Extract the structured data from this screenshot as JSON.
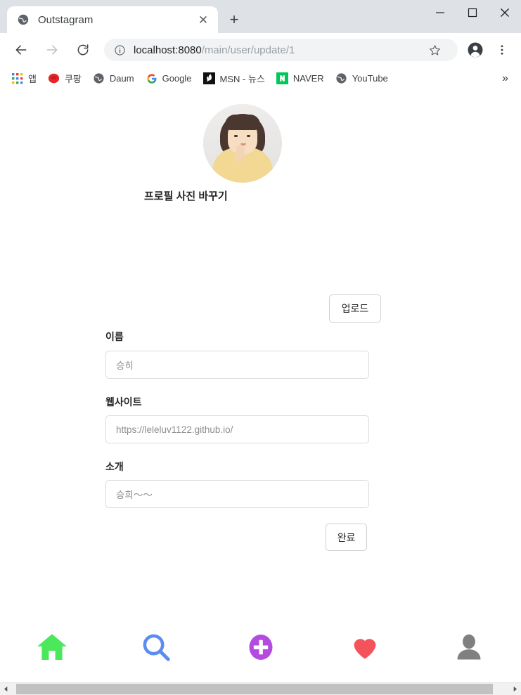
{
  "window": {
    "controls": [
      {
        "name": "minimize",
        "glyph": "—"
      },
      {
        "name": "maximize",
        "glyph": "☐"
      },
      {
        "name": "close",
        "glyph": "✕"
      }
    ]
  },
  "tabs": [
    {
      "title": "Outstagram",
      "favicon": "globe-icon",
      "close_glyph": "✕"
    }
  ],
  "newtab_glyph": "+",
  "toolbar": {
    "back_label": "←",
    "forward_label": "→",
    "reload_label": "↻",
    "url_host": "localhost:8080",
    "url_path": "/main/user/update/1",
    "url_full": "localhost:8080/main/user/update/1",
    "info_icon": "info-icon",
    "star_icon": "star-icon",
    "profile_icon": "account-icon",
    "menu_icon": "three-dot-menu-icon"
  },
  "bookmarks": {
    "apps_label": "앱",
    "items": [
      {
        "label": "쿠팡",
        "icon": "coupang-icon",
        "color": "#e52528"
      },
      {
        "label": "Daum",
        "icon": "globe-icon",
        "color": "#5f6368"
      },
      {
        "label": "Google",
        "icon": "google-g-icon",
        "color": "#4285f4"
      },
      {
        "label": "MSN - 뉴스",
        "icon": "msn-icon",
        "color": "#111111"
      },
      {
        "label": "NAVER",
        "icon": "naver-n-icon",
        "color": "#03c75a"
      },
      {
        "label": "YouTube",
        "icon": "globe-icon",
        "color": "#5f6368"
      }
    ],
    "overflow_glyph": "»"
  },
  "page": {
    "avatar_alt": "profile-photo",
    "change_photo_label": "프로필 사진 바꾸기",
    "upload_button_label": "업로드",
    "fields": [
      {
        "label": "이름",
        "value": "승히",
        "name": "name"
      },
      {
        "label": "웹사이트",
        "value": "https://leleluv1122.github.io/",
        "name": "website"
      },
      {
        "label": "소개",
        "value": "승희〜〜",
        "name": "bio"
      }
    ],
    "submit_button_label": "완료"
  },
  "bottom_nav": [
    {
      "name": "home",
      "icon": "home-icon",
      "color": "#4ce85c"
    },
    {
      "name": "search",
      "icon": "search-icon",
      "color": "#5b8df0"
    },
    {
      "name": "add-post",
      "icon": "plus-circle-icon",
      "color": "#b44be0"
    },
    {
      "name": "activity",
      "icon": "heart-icon",
      "color": "#f4535b"
    },
    {
      "name": "profile",
      "icon": "person-icon",
      "color": "#808080"
    }
  ],
  "scrollbar": {
    "left_arrow": "◀",
    "right_arrow": "▶"
  }
}
